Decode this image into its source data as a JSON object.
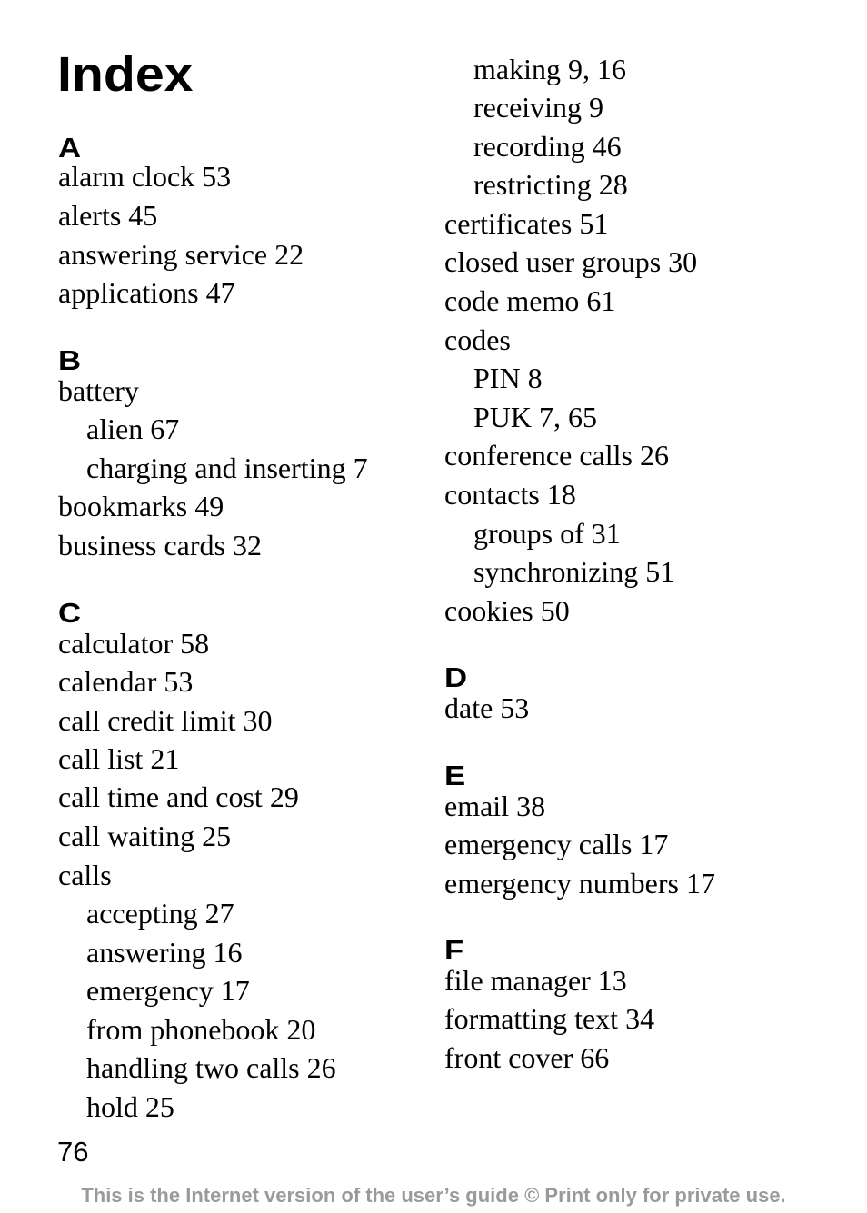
{
  "page": {
    "title": "Index",
    "page_number": "76",
    "footer": "This is the Internet version of the user’s guide © Print only for private use."
  },
  "left_column": {
    "A": {
      "letter": "A",
      "entries": [
        "alarm clock 53",
        "alerts 45",
        "answering service 22",
        "applications 47"
      ]
    },
    "B": {
      "letter": "B",
      "entries": [
        "battery",
        "alien 67",
        "charging and inserting 7",
        "bookmarks 49",
        "business cards 32"
      ]
    },
    "C": {
      "letter": "C",
      "entries": [
        "calculator 58",
        "calendar 53",
        "call credit limit 30",
        "call list 21",
        "call time and cost 29",
        "call waiting 25",
        "calls",
        "accepting 27",
        "answering 16",
        "emergency 17",
        "from phonebook 20",
        "handling two calls 26",
        "hold 25"
      ]
    }
  },
  "right_column": {
    "C_cont": {
      "entries": [
        "making 9, 16",
        "receiving 9",
        "recording 46",
        "restricting 28",
        "certificates 51",
        "closed user groups 30",
        "code memo 61",
        "codes",
        "PIN 8",
        "PUK 7, 65",
        "conference calls 26",
        "contacts 18",
        "groups of 31",
        "synchronizing 51",
        "cookies 50"
      ]
    },
    "D": {
      "letter": "D",
      "entries": [
        "date 53"
      ]
    },
    "E": {
      "letter": "E",
      "entries": [
        "email 38",
        "emergency calls 17",
        "emergency numbers 17"
      ]
    },
    "F": {
      "letter": "F",
      "entries": [
        "file manager 13",
        "formatting text 34",
        "front cover 66"
      ]
    }
  }
}
